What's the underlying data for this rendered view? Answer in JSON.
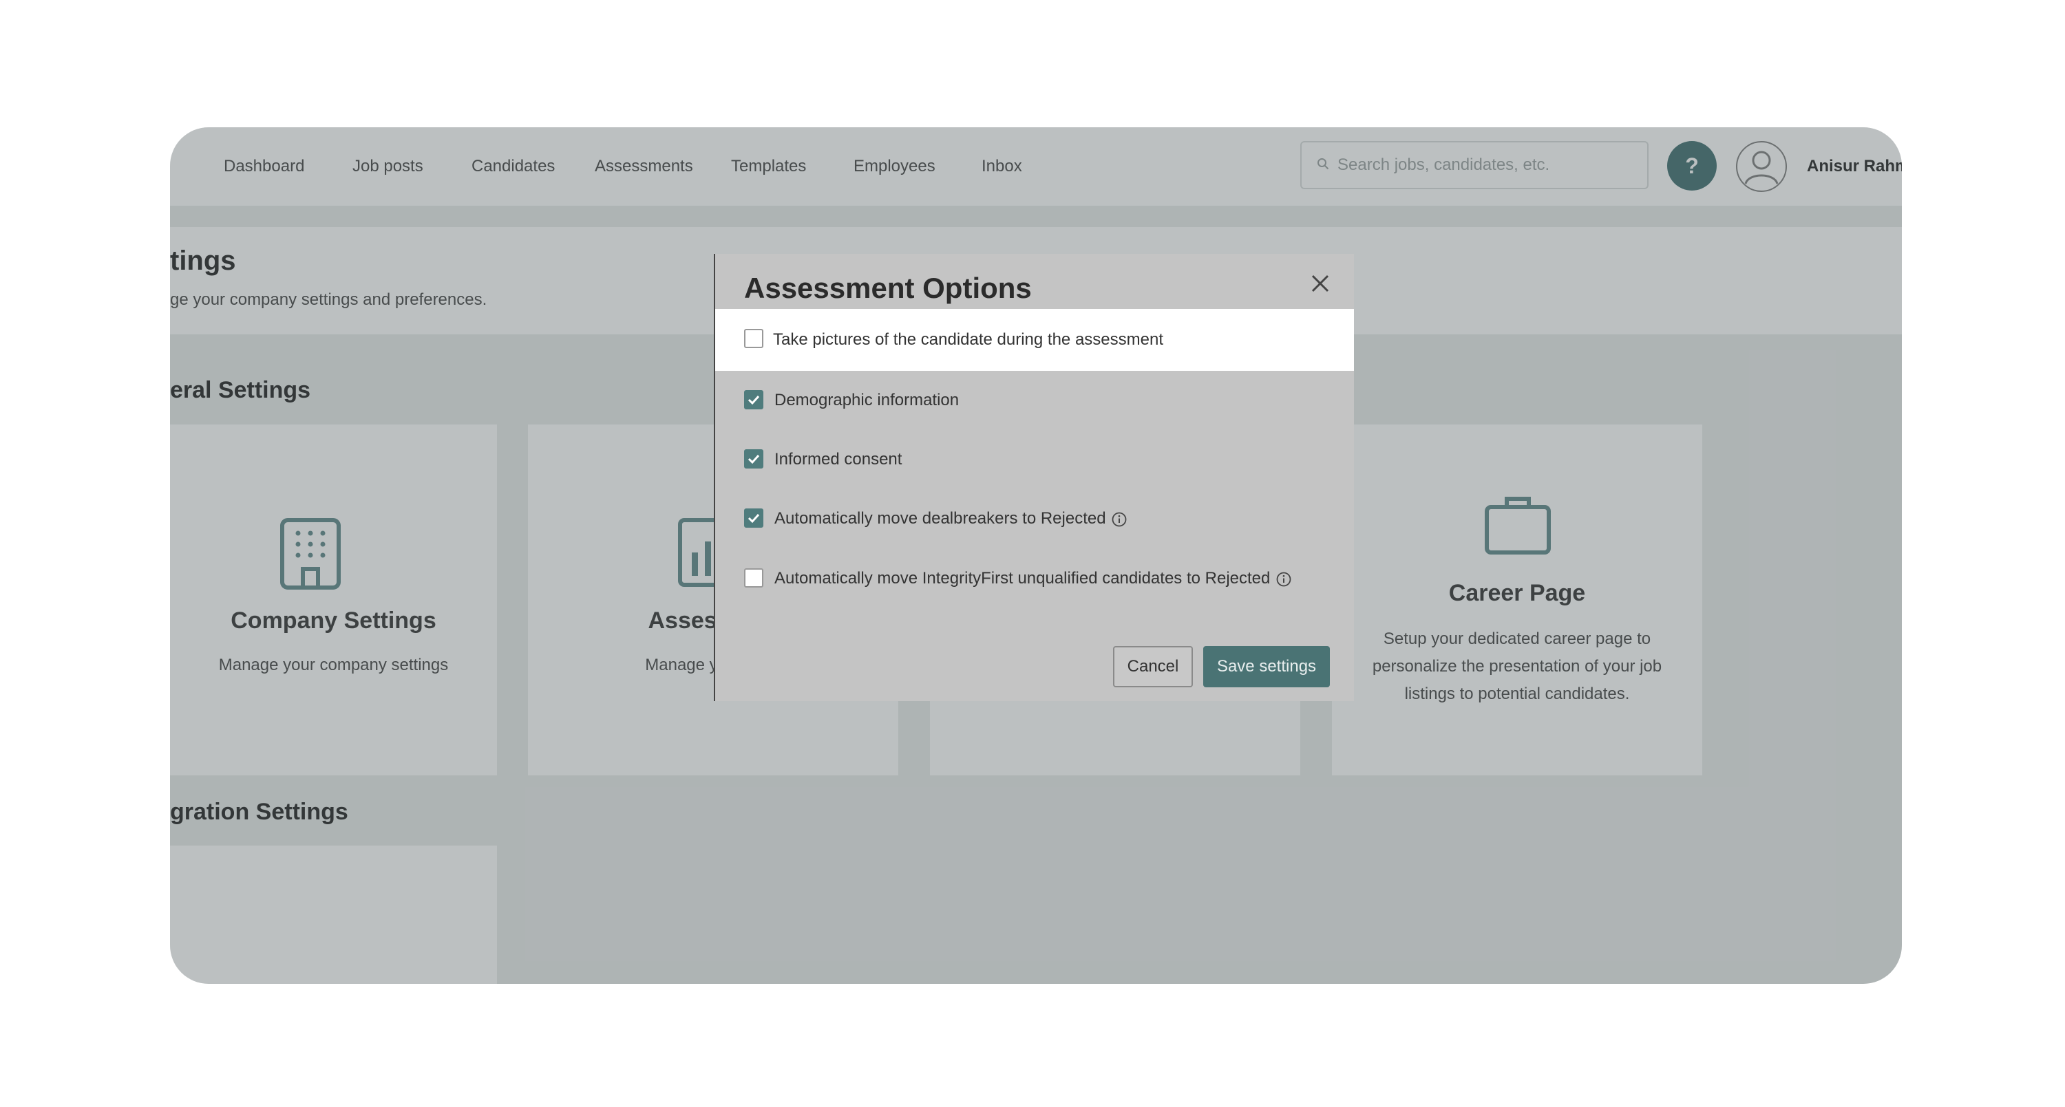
{
  "nav": {
    "items": [
      {
        "label": "Dashboard",
        "name": "nav-dashboard"
      },
      {
        "label": "Job posts",
        "name": "nav-job-posts"
      },
      {
        "label": "Candidates",
        "name": "nav-candidates"
      },
      {
        "label": "Assessments",
        "name": "nav-assessments"
      },
      {
        "label": "Templates",
        "name": "nav-templates"
      },
      {
        "label": "Employees",
        "name": "nav-employees"
      },
      {
        "label": "Inbox",
        "name": "nav-inbox"
      }
    ],
    "search_placeholder": "Search jobs, candidates, etc.",
    "help_label": "?",
    "user_name": "Anisur Rahm"
  },
  "page": {
    "title": "tings",
    "subtitle": "ge your company settings and preferences.",
    "general_section": "eral Settings",
    "integration_section": "gration Settings"
  },
  "cards": {
    "company": {
      "title": "Company Settings",
      "desc": "Manage your company settings"
    },
    "assessment": {
      "title": "Assessmen",
      "desc": "Manage your asse"
    },
    "career": {
      "title": "Career Page",
      "desc": "Setup your dedicated career page to personalize the presentation of your job listings to potential candidates."
    }
  },
  "modal": {
    "title": "Assessment Options",
    "options": [
      {
        "label": "Take pictures of the candidate during the assessment",
        "checked": false
      },
      {
        "label": "Demographic information",
        "checked": true
      },
      {
        "label": "Informed consent",
        "checked": true
      },
      {
        "label": "Automatically move dealbreakers to Rejected",
        "checked": true
      },
      {
        "label": "Automatically move IntegrityFirst unqualified candidates to Rejected",
        "checked": false
      }
    ],
    "cancel_label": "Cancel",
    "save_label": "Save settings"
  },
  "colors": {
    "accent": "#4a7374",
    "icon": "#5e8889",
    "overlay": "#8e9a9b"
  }
}
